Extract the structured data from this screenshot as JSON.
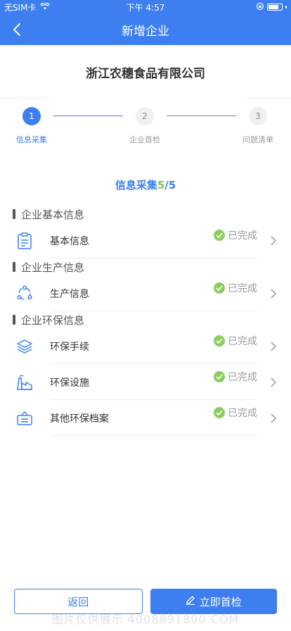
{
  "status_bar": {
    "carrier": "无SIM卡",
    "time": "下午 4:57"
  },
  "nav": {
    "title": "新增企业"
  },
  "company_name": "浙江农穗食品有限公司",
  "stepper": [
    {
      "number": "1",
      "label": "信息采集",
      "active": true
    },
    {
      "number": "2",
      "label": "企业首检",
      "active": false
    },
    {
      "number": "3",
      "label": "问题清单",
      "active": false
    }
  ],
  "progress": {
    "label": "信息采集",
    "done": "5",
    "total": "/5"
  },
  "sections": [
    {
      "title": "企业基本信息",
      "items": [
        {
          "label": "基本信息",
          "status": "已完成",
          "icon": "clipboard-icon"
        }
      ]
    },
    {
      "title": "企业生产信息",
      "items": [
        {
          "label": "生产信息",
          "status": "已完成",
          "icon": "cycle-icon"
        }
      ]
    },
    {
      "title": "企业环保信息",
      "items": [
        {
          "label": "环保手续",
          "status": "已完成",
          "icon": "layers-icon"
        },
        {
          "label": "环保设施",
          "status": "已完成",
          "icon": "factory-icon"
        },
        {
          "label": "其他环保档案",
          "status": "已完成",
          "icon": "archive-box-icon"
        }
      ]
    }
  ],
  "buttons": {
    "back": "返回",
    "inspect": "立即首检"
  },
  "watermark": "图片仅供展示 4008891800.COM",
  "colors": {
    "primary": "#3d7ff0",
    "success": "#8ccd5f",
    "progress_done": "#7ac55c"
  }
}
